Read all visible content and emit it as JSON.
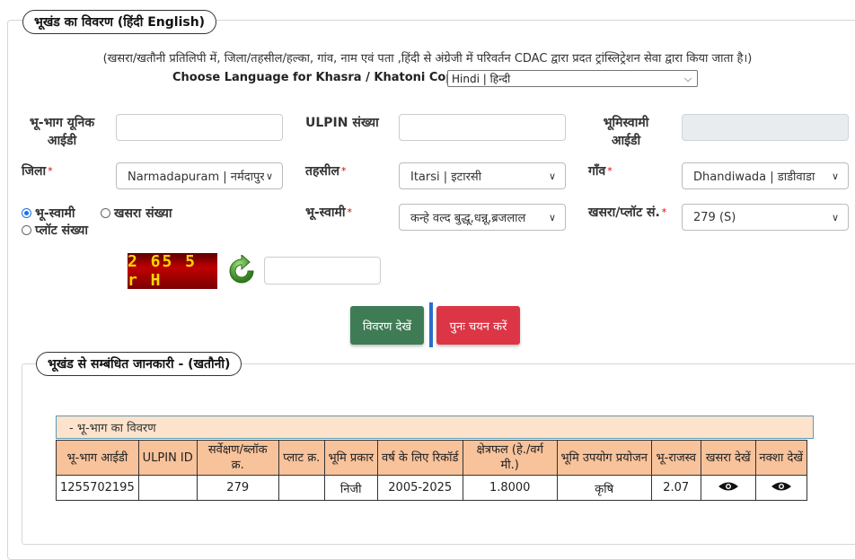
{
  "section1": {
    "legend": "भूखंड का विवरण  (हिंदी  English)",
    "note": "(खसरा/खतौनी प्रतिलिपी में, जिला/तहसील/हल्का, गांव, नाम एवं पता ,हिंदी से अंग्रेजी में परिवर्तन CDAC द्वारा प्रदत ट्रांस्लिट्रेशन सेवा द्वारा किया जाता है।)",
    "choose_language_label": "Choose Language for Khasra / Khatoni Copy:",
    "language_selected": "Hindi | हिन्दी"
  },
  "form": {
    "unique_id_label": "भू-भाग यूनिक आईडी",
    "unique_id_value": "",
    "ulpin_label": "ULPIN संख्या",
    "ulpin_value": "",
    "owner_id_label": "भूमिस्वामी आईडी",
    "owner_id_value": "",
    "district_label": "जिला",
    "district_value": "Narmadapuram | नर्मदापुरम",
    "tehsil_label": "तहसील",
    "tehsil_value": "Itarsi | इटारसी",
    "village_label": "गाँव",
    "village_value": "Dhandiwada | डाडीवाडा",
    "radio_owner": "भू-स्वामी",
    "radio_khasra": "खसरा संख्या",
    "radio_plot": "प्लॉट संख्या",
    "owner_label": "भू-स्वामी",
    "owner_value": "कन्हे वल्द बुद्धू,धन्नू,ब्रजलाल",
    "khasra_plot_label": "खसरा/प्लॉट सं.",
    "khasra_plot_value": "279 (S)",
    "required_mark": "*",
    "captcha_text": "2 65 5 r H",
    "captcha_input_value": ""
  },
  "buttons": {
    "view_details": "विवरण देखें",
    "reset": "पुनः चयन करें"
  },
  "section2": {
    "legend": "भूखंड से सम्बंधित जानकारी -   (खतौनी)",
    "table_title": "- भू-भाग का विवरण",
    "headers": [
      "भू-भाग आईडी",
      "ULPIN ID",
      "सर्वेक्षण/ब्लॉक क्र.",
      "प्लाट क्र.",
      "भूमि प्रकार",
      "वर्ष के लिए रिकॉर्ड",
      "क्षेत्रफल (हे./वर्ग मी.)",
      "भूमि उपयोग प्रयोजन",
      "भू-राजस्व",
      "खसरा देखें",
      "नक्शा देखें"
    ],
    "row": {
      "land_id": "1255702195",
      "ulpin": "",
      "survey_no": "279",
      "plot_no": "",
      "land_type": "निजी",
      "year": "2005-2025",
      "area": "1.8000",
      "usage": "कृषि",
      "revenue": "2.07"
    }
  },
  "colors": {
    "btn_green": "#3f7c55",
    "btn_red": "#dc3545",
    "table_header": "#f8c29b",
    "table_title_bar": "#fde3cc",
    "divider": "#2c6cc9"
  }
}
